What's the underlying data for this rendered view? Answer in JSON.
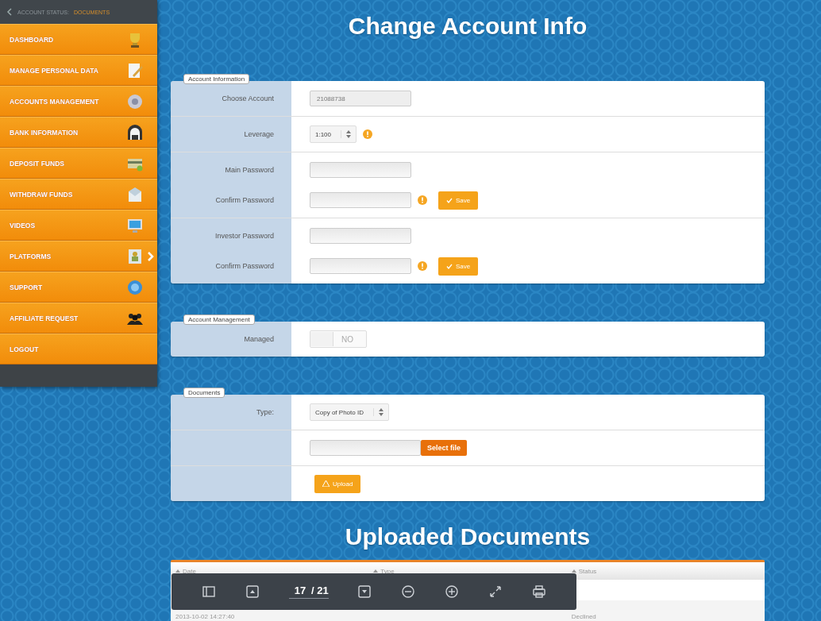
{
  "sidebar": {
    "status_label": "ACCOUNT STATUS:",
    "status_value": "DOCUMENTS",
    "items": [
      {
        "label": "DASHBOARD",
        "has_submenu": false
      },
      {
        "label": "MANAGE PERSONAL DATA",
        "has_submenu": false
      },
      {
        "label": "ACCOUNTS MANAGEMENT",
        "has_submenu": false
      },
      {
        "label": "BANK INFORMATION",
        "has_submenu": false
      },
      {
        "label": "DEPOSIT FUNDS",
        "has_submenu": false
      },
      {
        "label": "WITHDRAW FUNDS",
        "has_submenu": false
      },
      {
        "label": "VIDEOS",
        "has_submenu": false
      },
      {
        "label": "PLATFORMS",
        "has_submenu": true
      },
      {
        "label": "SUPPORT",
        "has_submenu": false
      },
      {
        "label": "AFFILIATE REQUEST",
        "has_submenu": false
      },
      {
        "label": "LOGOUT",
        "has_submenu": false
      }
    ]
  },
  "title": "Change Account Info",
  "panels": [
    {
      "legend": "Account Information",
      "groups": [
        [
          {
            "kind": "select",
            "label": "Choose Account",
            "value": "21088738",
            "disabled": true
          }
        ],
        [
          {
            "kind": "stepper",
            "label": "Leverage",
            "value": "1:100",
            "info": true
          }
        ],
        [
          {
            "kind": "field",
            "label": "Main Password"
          },
          {
            "kind": "field",
            "label": "Confirm Password",
            "info": true,
            "button": "Save"
          }
        ],
        [
          {
            "kind": "field",
            "label": "Investor Password"
          },
          {
            "kind": "field",
            "label": "Confirm Password",
            "info": true,
            "button": "Save"
          }
        ]
      ]
    },
    {
      "legend": "Account Management",
      "groups": [
        [
          {
            "kind": "toggle",
            "label": "Managed",
            "value": "NO",
            "on": false
          }
        ]
      ]
    },
    {
      "legend": "Documents",
      "groups": [
        [
          {
            "kind": "stepper",
            "label": "Type:",
            "value": "Copy of Photo ID",
            "info": false
          }
        ],
        [
          {
            "kind": "file",
            "button": "Select file"
          }
        ],
        [
          {
            "kind": "upload",
            "button": "Upload"
          }
        ]
      ]
    }
  ],
  "uploaded_title": "Uploaded Documents",
  "table": {
    "columns": [
      "Date",
      "Type",
      "Status"
    ],
    "rows": [
      {
        "date": "2013-10-02 14:27:40",
        "status": "Declined"
      }
    ]
  },
  "viewer": {
    "page": "17",
    "total": "/ 21"
  }
}
